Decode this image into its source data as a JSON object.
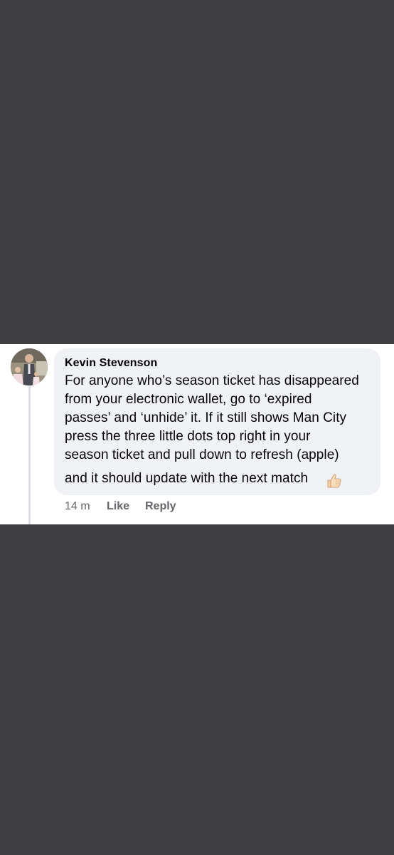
{
  "comment": {
    "author": "Kevin Stevenson",
    "lines": [
      "For anyone who’s season ticket has disappeared",
      "from your electronic wallet, go to ‘expired",
      "passes’ and ‘unhide’ it. If it still shows Man City",
      "press the three little dots top right in your",
      "season ticket and pull down to refresh (apple)",
      "and it should update with the next match"
    ],
    "reaction_emoji": "thumbs-up-icon",
    "timestamp": "14 m",
    "like_label": "Like",
    "reply_label": "Reply"
  },
  "colors": {
    "background": "#3f3f41",
    "bubble": "#f0f2f5",
    "text": "#050505",
    "meta": "#65676b"
  }
}
